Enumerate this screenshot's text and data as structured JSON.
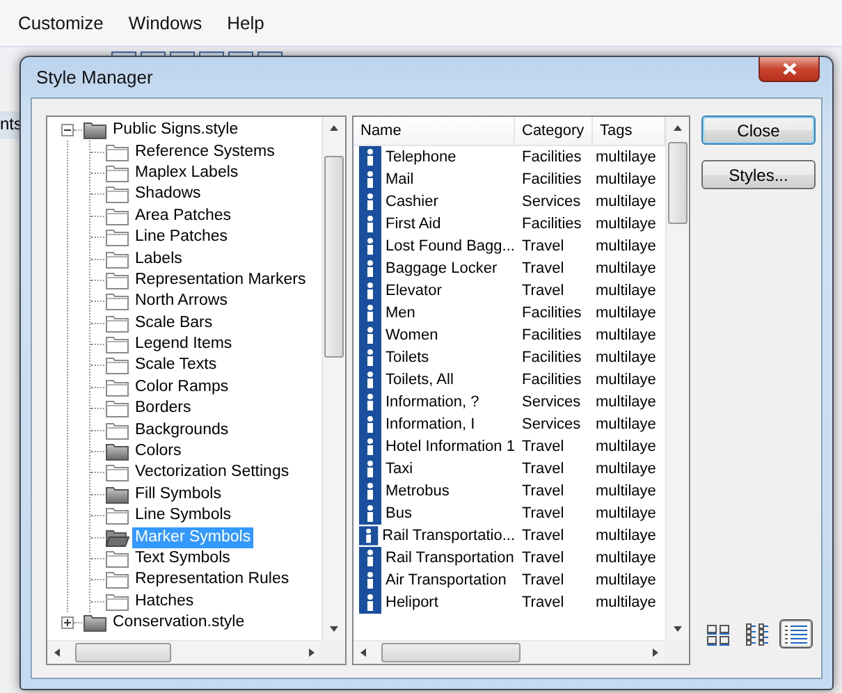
{
  "app": {
    "menu": [
      "Customize",
      "Windows",
      "Help"
    ],
    "side_text": "nts"
  },
  "dialog": {
    "title": "Style Manager"
  },
  "tree": [
    {
      "label": "Public Signs.style",
      "kind": "filled",
      "expanded": true,
      "selected": false,
      "children": [
        {
          "label": "Reference Systems",
          "kind": "empty",
          "selected": false
        },
        {
          "label": "Maplex Labels",
          "kind": "empty",
          "selected": false
        },
        {
          "label": "Shadows",
          "kind": "empty",
          "selected": false
        },
        {
          "label": "Area Patches",
          "kind": "empty",
          "selected": false
        },
        {
          "label": "Line Patches",
          "kind": "empty",
          "selected": false
        },
        {
          "label": "Labels",
          "kind": "empty",
          "selected": false
        },
        {
          "label": "Representation Markers",
          "kind": "empty",
          "selected": false
        },
        {
          "label": "North Arrows",
          "kind": "empty",
          "selected": false
        },
        {
          "label": "Scale Bars",
          "kind": "empty",
          "selected": false
        },
        {
          "label": "Legend Items",
          "kind": "empty",
          "selected": false
        },
        {
          "label": "Scale Texts",
          "kind": "empty",
          "selected": false
        },
        {
          "label": "Color Ramps",
          "kind": "empty",
          "selected": false
        },
        {
          "label": "Borders",
          "kind": "empty",
          "selected": false
        },
        {
          "label": "Backgrounds",
          "kind": "empty",
          "selected": false
        },
        {
          "label": "Colors",
          "kind": "filled",
          "selected": false
        },
        {
          "label": "Vectorization Settings",
          "kind": "empty",
          "selected": false
        },
        {
          "label": "Fill Symbols",
          "kind": "filled",
          "selected": false
        },
        {
          "label": "Line Symbols",
          "kind": "empty",
          "selected": false
        },
        {
          "label": "Marker Symbols",
          "kind": "open",
          "selected": true
        },
        {
          "label": "Text Symbols",
          "kind": "empty",
          "selected": false
        },
        {
          "label": "Representation Rules",
          "kind": "empty",
          "selected": false
        },
        {
          "label": "Hatches",
          "kind": "empty",
          "selected": false
        }
      ]
    },
    {
      "label": "Conservation.style",
      "kind": "filled",
      "expanded": false,
      "selected": false
    }
  ],
  "list": {
    "columns": [
      "Name",
      "Category",
      "Tags"
    ],
    "rows": [
      {
        "name": "Telephone",
        "category": "Facilities",
        "tags": "multilaye"
      },
      {
        "name": "Mail",
        "category": "Facilities",
        "tags": "multilaye"
      },
      {
        "name": "Cashier",
        "category": "Services",
        "tags": "multilaye"
      },
      {
        "name": "First Aid",
        "category": "Facilities",
        "tags": "multilaye"
      },
      {
        "name": "Lost Found Bagg...",
        "category": "Travel",
        "tags": "multilaye"
      },
      {
        "name": "Baggage Locker",
        "category": "Travel",
        "tags": "multilaye"
      },
      {
        "name": "Elevator",
        "category": "Travel",
        "tags": "multilaye"
      },
      {
        "name": "Men",
        "category": "Facilities",
        "tags": "multilaye"
      },
      {
        "name": "Women",
        "category": "Facilities",
        "tags": "multilaye"
      },
      {
        "name": "Toilets",
        "category": "Facilities",
        "tags": "multilaye"
      },
      {
        "name": "Toilets, All",
        "category": "Facilities",
        "tags": "multilaye"
      },
      {
        "name": "Information, ?",
        "category": "Services",
        "tags": "multilaye"
      },
      {
        "name": "Information, I",
        "category": "Services",
        "tags": "multilaye"
      },
      {
        "name": "Hotel Information 1",
        "category": "Travel",
        "tags": "multilaye"
      },
      {
        "name": "Taxi",
        "category": "Travel",
        "tags": "multilaye"
      },
      {
        "name": "Metrobus",
        "category": "Travel",
        "tags": "multilaye"
      },
      {
        "name": "Bus",
        "category": "Travel",
        "tags": "multilaye"
      },
      {
        "name": "Rail Transportatio...",
        "category": "Travel",
        "tags": "multilaye"
      },
      {
        "name": "Rail Transportation",
        "category": "Travel",
        "tags": "multilaye"
      },
      {
        "name": "Air Transportation",
        "category": "Travel",
        "tags": "multilaye"
      },
      {
        "name": "Heliport",
        "category": "Travel",
        "tags": "multilaye"
      }
    ]
  },
  "buttons": [
    {
      "label": "Close",
      "default": true
    },
    {
      "label": "Styles...",
      "default": false
    }
  ],
  "views": [
    {
      "kind": "large",
      "selected": false
    },
    {
      "kind": "small",
      "selected": false
    },
    {
      "kind": "details",
      "selected": true
    }
  ]
}
